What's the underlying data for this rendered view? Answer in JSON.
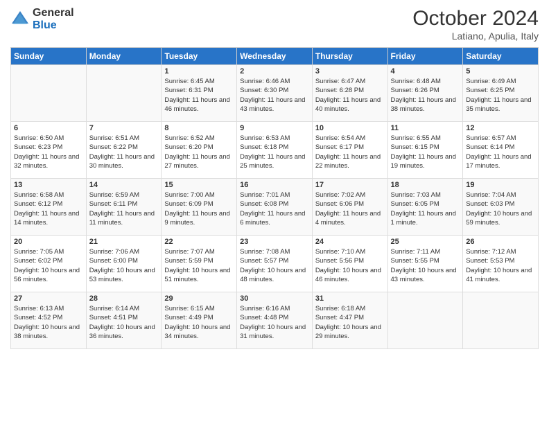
{
  "header": {
    "logo_general": "General",
    "logo_blue": "Blue",
    "month": "October 2024",
    "location": "Latiano, Apulia, Italy"
  },
  "weekdays": [
    "Sunday",
    "Monday",
    "Tuesday",
    "Wednesday",
    "Thursday",
    "Friday",
    "Saturday"
  ],
  "weeks": [
    [
      {
        "day": "",
        "content": ""
      },
      {
        "day": "",
        "content": ""
      },
      {
        "day": "1",
        "content": "Sunrise: 6:45 AM\nSunset: 6:31 PM\nDaylight: 11 hours and 46 minutes."
      },
      {
        "day": "2",
        "content": "Sunrise: 6:46 AM\nSunset: 6:30 PM\nDaylight: 11 hours and 43 minutes."
      },
      {
        "day": "3",
        "content": "Sunrise: 6:47 AM\nSunset: 6:28 PM\nDaylight: 11 hours and 40 minutes."
      },
      {
        "day": "4",
        "content": "Sunrise: 6:48 AM\nSunset: 6:26 PM\nDaylight: 11 hours and 38 minutes."
      },
      {
        "day": "5",
        "content": "Sunrise: 6:49 AM\nSunset: 6:25 PM\nDaylight: 11 hours and 35 minutes."
      }
    ],
    [
      {
        "day": "6",
        "content": "Sunrise: 6:50 AM\nSunset: 6:23 PM\nDaylight: 11 hours and 32 minutes."
      },
      {
        "day": "7",
        "content": "Sunrise: 6:51 AM\nSunset: 6:22 PM\nDaylight: 11 hours and 30 minutes."
      },
      {
        "day": "8",
        "content": "Sunrise: 6:52 AM\nSunset: 6:20 PM\nDaylight: 11 hours and 27 minutes."
      },
      {
        "day": "9",
        "content": "Sunrise: 6:53 AM\nSunset: 6:18 PM\nDaylight: 11 hours and 25 minutes."
      },
      {
        "day": "10",
        "content": "Sunrise: 6:54 AM\nSunset: 6:17 PM\nDaylight: 11 hours and 22 minutes."
      },
      {
        "day": "11",
        "content": "Sunrise: 6:55 AM\nSunset: 6:15 PM\nDaylight: 11 hours and 19 minutes."
      },
      {
        "day": "12",
        "content": "Sunrise: 6:57 AM\nSunset: 6:14 PM\nDaylight: 11 hours and 17 minutes."
      }
    ],
    [
      {
        "day": "13",
        "content": "Sunrise: 6:58 AM\nSunset: 6:12 PM\nDaylight: 11 hours and 14 minutes."
      },
      {
        "day": "14",
        "content": "Sunrise: 6:59 AM\nSunset: 6:11 PM\nDaylight: 11 hours and 11 minutes."
      },
      {
        "day": "15",
        "content": "Sunrise: 7:00 AM\nSunset: 6:09 PM\nDaylight: 11 hours and 9 minutes."
      },
      {
        "day": "16",
        "content": "Sunrise: 7:01 AM\nSunset: 6:08 PM\nDaylight: 11 hours and 6 minutes."
      },
      {
        "day": "17",
        "content": "Sunrise: 7:02 AM\nSunset: 6:06 PM\nDaylight: 11 hours and 4 minutes."
      },
      {
        "day": "18",
        "content": "Sunrise: 7:03 AM\nSunset: 6:05 PM\nDaylight: 11 hours and 1 minute."
      },
      {
        "day": "19",
        "content": "Sunrise: 7:04 AM\nSunset: 6:03 PM\nDaylight: 10 hours and 59 minutes."
      }
    ],
    [
      {
        "day": "20",
        "content": "Sunrise: 7:05 AM\nSunset: 6:02 PM\nDaylight: 10 hours and 56 minutes."
      },
      {
        "day": "21",
        "content": "Sunrise: 7:06 AM\nSunset: 6:00 PM\nDaylight: 10 hours and 53 minutes."
      },
      {
        "day": "22",
        "content": "Sunrise: 7:07 AM\nSunset: 5:59 PM\nDaylight: 10 hours and 51 minutes."
      },
      {
        "day": "23",
        "content": "Sunrise: 7:08 AM\nSunset: 5:57 PM\nDaylight: 10 hours and 48 minutes."
      },
      {
        "day": "24",
        "content": "Sunrise: 7:10 AM\nSunset: 5:56 PM\nDaylight: 10 hours and 46 minutes."
      },
      {
        "day": "25",
        "content": "Sunrise: 7:11 AM\nSunset: 5:55 PM\nDaylight: 10 hours and 43 minutes."
      },
      {
        "day": "26",
        "content": "Sunrise: 7:12 AM\nSunset: 5:53 PM\nDaylight: 10 hours and 41 minutes."
      }
    ],
    [
      {
        "day": "27",
        "content": "Sunrise: 6:13 AM\nSunset: 4:52 PM\nDaylight: 10 hours and 38 minutes."
      },
      {
        "day": "28",
        "content": "Sunrise: 6:14 AM\nSunset: 4:51 PM\nDaylight: 10 hours and 36 minutes."
      },
      {
        "day": "29",
        "content": "Sunrise: 6:15 AM\nSunset: 4:49 PM\nDaylight: 10 hours and 34 minutes."
      },
      {
        "day": "30",
        "content": "Sunrise: 6:16 AM\nSunset: 4:48 PM\nDaylight: 10 hours and 31 minutes."
      },
      {
        "day": "31",
        "content": "Sunrise: 6:18 AM\nSunset: 4:47 PM\nDaylight: 10 hours and 29 minutes."
      },
      {
        "day": "",
        "content": ""
      },
      {
        "day": "",
        "content": ""
      }
    ]
  ]
}
